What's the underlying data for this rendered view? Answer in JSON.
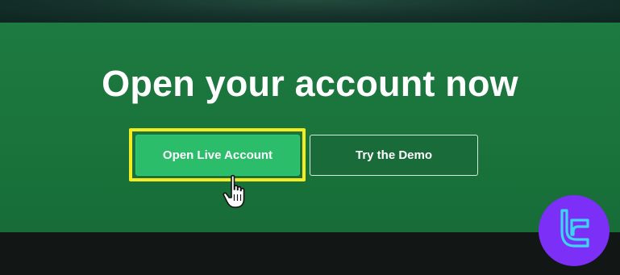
{
  "hero": {
    "headline": "Open your account now",
    "background_color": "#1d7a40"
  },
  "buttons": {
    "live_label": "Open Live Account",
    "demo_label": "Try the Demo",
    "live_color": "#2cbd6b",
    "highlight_color": "#f4ec1e"
  },
  "overlay": {
    "cursor_icon": "hand-pointer-icon",
    "watermark_logo": "tc-logo",
    "watermark_color": "#7b2ff7"
  }
}
